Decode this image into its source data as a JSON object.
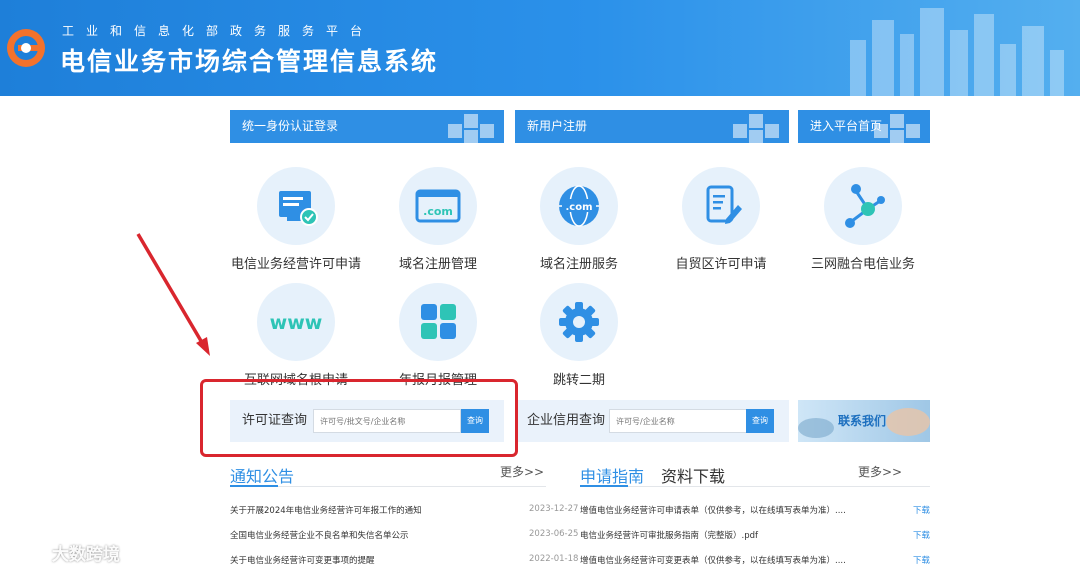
{
  "header": {
    "subtitle": "工业和信息化部政务服务平台",
    "title": "电信业务市场综合管理信息系统"
  },
  "nav": {
    "login": "统一身份认证登录",
    "register": "新用户注册",
    "home": "进入平台首页"
  },
  "services": [
    {
      "label": "电信业务经营许可申请",
      "icon": "license-monitor-icon"
    },
    {
      "label": "域名注册管理",
      "icon": "dotcom-window-icon"
    },
    {
      "label": "域名注册服务",
      "icon": "dotcom-globe-icon"
    },
    {
      "label": "自贸区许可申请",
      "icon": "document-edit-icon"
    },
    {
      "label": "三网融合电信业务",
      "icon": "network-nodes-icon"
    },
    {
      "label": "互联网域名根申请",
      "icon": "www-icon"
    },
    {
      "label": "年报月报管理",
      "icon": "grid-tiles-icon"
    },
    {
      "label": "跳转二期",
      "icon": "gear-icon"
    }
  ],
  "license_search": {
    "label": "许可证查询",
    "placeholder": "许可号/批文号/企业名称",
    "button": "查询"
  },
  "credit_search": {
    "label": "企业信用查询",
    "placeholder": "许可号/企业名称",
    "button": "查询"
  },
  "contact": {
    "label": "联系我们"
  },
  "notice_tabs": {
    "notice": "通知公告",
    "more": "更多>>"
  },
  "guide_tabs": {
    "guide": "申请指南",
    "download": "资料下载",
    "more": "更多>>"
  },
  "notices": [
    {
      "title": "关于开展2024年电信业务经营许可年报工作的通知",
      "date": "2023-12-27"
    },
    {
      "title": "全国电信业务经营企业不良名单和失信名单公示",
      "date": "2023-06-25"
    },
    {
      "title": "关于电信业务经营许可变更事项的提醒",
      "date": "2022-01-18"
    }
  ],
  "guides": [
    {
      "title": "增值电信业务经营许可申请表单（仅供参考，以在线填写表单为准）....",
      "action": "下载"
    },
    {
      "title": "电信业务经营许可审批服务指南（完整版）.pdf",
      "action": "下载"
    },
    {
      "title": "增值电信业务经营许可变更表单（仅供参考，以在线填写表单为准）....",
      "action": "下载"
    }
  ],
  "watermark": "大数跨境",
  "colors": {
    "primary": "#2f8fe4",
    "highlight": "#d9262e",
    "header": "#2b91ea"
  }
}
